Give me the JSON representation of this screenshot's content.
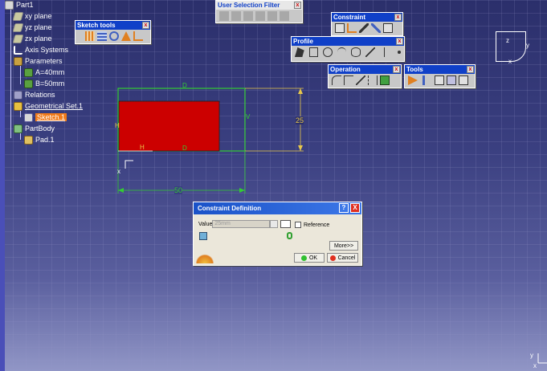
{
  "tree": {
    "root": "Part1",
    "items": [
      {
        "label": "xy plane"
      },
      {
        "label": "yz plane"
      },
      {
        "label": "zx plane"
      },
      {
        "label": "Axis Systems"
      },
      {
        "label": "Parameters"
      },
      {
        "label": "A=40mm"
      },
      {
        "label": "B=50mm"
      },
      {
        "label": "Relations"
      },
      {
        "label": "Geometrical Set.1"
      },
      {
        "label": "Sketch.1"
      },
      {
        "label": "PartBody"
      },
      {
        "label": "Pad.1"
      }
    ]
  },
  "toolbars": {
    "sketch_tools": "Sketch tools",
    "user_selection_filter": "User Selection Filter",
    "constraint": "Constraint",
    "profile": "Profile",
    "operation": "Operation",
    "tools": "Tools",
    "close": "x"
  },
  "sketch": {
    "dim_height": "25",
    "dim_width": "50",
    "label_h": "H",
    "label_v": "V",
    "label_d_top": "D",
    "label_d_bottom": "D",
    "label_h_left": "H",
    "origin_label": "x"
  },
  "compass": {
    "x": "x",
    "y": "y",
    "z": "z"
  },
  "dialog": {
    "title": "Constraint Definition",
    "help": "?",
    "close": "X",
    "value_label": "Value",
    "value": "25mm",
    "reference_label": "Reference",
    "more": "More>>",
    "ok": "OK",
    "cancel": "Cancel"
  },
  "axis_corner": {
    "y": "y",
    "x": "x"
  },
  "colors": {
    "rect_fill": "#cc0000",
    "constraint_green": "#33cc33",
    "dim_yellow": "#e8c84a",
    "selection_orange": "#f07a1a",
    "title_blue": "#1040c8"
  }
}
